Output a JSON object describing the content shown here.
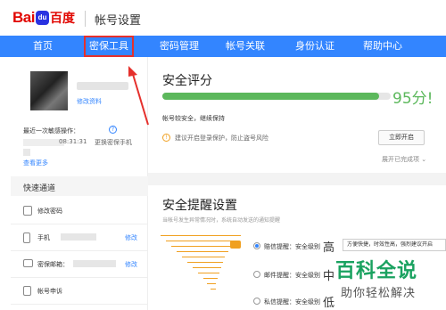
{
  "header": {
    "logo_baidu": "Bai",
    "logo_du": "du",
    "logo_cn": "百度",
    "app_title": "帐号设置"
  },
  "nav": {
    "items": [
      "首页",
      "密保工具",
      "密码管理",
      "帐号关联",
      "身份认证",
      "帮助中心"
    ],
    "highlighted": "密保工具",
    "highlight_color": "#e5302c",
    "bar_color": "#3385ff"
  },
  "sidebar": {
    "edit_profile": "修改资料",
    "last_op_label": "最近一次敏感操作：",
    "last_op_time": "08:31:31",
    "last_op_desc": "更换密保手机",
    "view_more": "查看更多",
    "quick_title": "快速通道",
    "quick_links": [
      {
        "label": "修改密码",
        "icon": "lock-icon",
        "action": ""
      },
      {
        "label": "手机",
        "icon": "phone-icon",
        "action": "修改"
      },
      {
        "label": "密保邮箱：",
        "icon": "mail-icon",
        "action": "修改"
      },
      {
        "label": "帐号申诉",
        "icon": "document-icon",
        "action": ""
      }
    ]
  },
  "main": {
    "score_title": "安全评分",
    "score_value": "95分!",
    "score_fraction": 0.95,
    "score_desc": "帐号较安全，继续保持",
    "warning_text": "建议开启登录保护，防止盗号风险",
    "enable_button": "立即开启",
    "expand_text": "展开已完成项",
    "remind_title": "安全提醒设置",
    "remind_desc": "当帐号发生异常情况时，系统自动发送的通知提醒",
    "options": [
      {
        "label": "赔信提醒：安全级别",
        "level": "高",
        "selected": true
      },
      {
        "label": "邮件提醒：安全级别",
        "level": "中",
        "selected": false
      },
      {
        "label": "私信提醒：安全级别",
        "level": "低",
        "selected": false
      }
    ],
    "tooltip": "方便快捷，时效性高，强烈建议开启"
  },
  "watermark": {
    "title": "百科全说",
    "subtitle": "助你轻松解决"
  }
}
